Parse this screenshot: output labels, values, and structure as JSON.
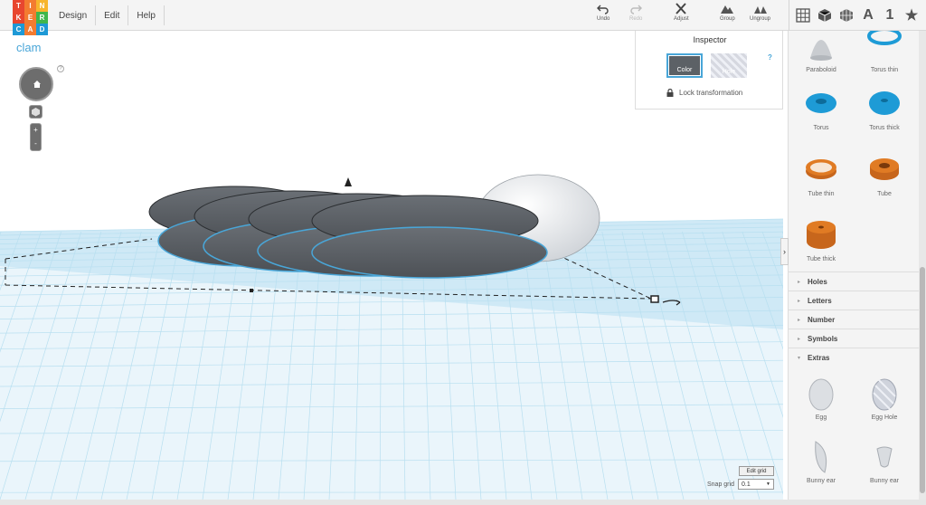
{
  "app": {
    "logo_letters": [
      "T",
      "I",
      "N",
      "K",
      "E",
      "R",
      "C",
      "A",
      "D"
    ],
    "logo_colors": [
      "#e8462f",
      "#f37b30",
      "#f7b52d",
      "#e8462f",
      "#f37b30",
      "#3fb64c",
      "#1e99d6",
      "#f37b30",
      "#1e99d6"
    ]
  },
  "menu": [
    "Design",
    "Edit",
    "Help"
  ],
  "toolbar": {
    "undo": "Undo",
    "redo": "Redo",
    "adjust": "Adjust",
    "group": "Group",
    "ungroup": "Ungroup"
  },
  "view_icons": [
    "grid-view-icon",
    "cube-icon",
    "wireframe-cube-icon",
    "text-A-icon",
    "number-1-icon",
    "star-icon"
  ],
  "view_text": {
    "letter": "A",
    "number": "1",
    "star": "★"
  },
  "project": {
    "name": "clam"
  },
  "nav": {
    "help": "?",
    "zoom_in": "+",
    "zoom_out": "-"
  },
  "inspector": {
    "title": "Inspector",
    "help": "?",
    "color_label": "Color",
    "hole_label": "Hole",
    "lock_label": "Lock transformation",
    "color_value": "#5c6166"
  },
  "grid": {
    "edit_label": "Edit grid",
    "snap_label": "Snap grid",
    "snap_value": "0.1"
  },
  "sidebar": {
    "shapes_top": [
      {
        "label": "Paraboloid",
        "icon": "paraboloid-icon"
      },
      {
        "label": "Torus thin",
        "icon": "torus-thin-icon"
      },
      {
        "label": "Torus",
        "icon": "torus-icon"
      },
      {
        "label": "Torus thick",
        "icon": "torus-thick-icon"
      },
      {
        "label": "Tube thin",
        "icon": "tube-thin-icon"
      },
      {
        "label": "Tube",
        "icon": "tube-icon"
      },
      {
        "label": "Tube thick",
        "icon": "tube-thick-icon"
      }
    ],
    "sections": [
      "Holes",
      "Letters",
      "Number",
      "Symbols",
      "Extras"
    ],
    "extras": [
      {
        "label": "Egg",
        "icon": "egg-icon"
      },
      {
        "label": "Egg Hole",
        "icon": "egg-hole-icon"
      },
      {
        "label": "Bunny ear",
        "icon": "bunny-ear-icon"
      },
      {
        "label": "Bunny ear",
        "icon": "bunny-ear-2-icon"
      }
    ]
  },
  "colors": {
    "accent": "#49a6d8",
    "torus": "#1e9bd6",
    "tube": "#e07b24",
    "shell": "#5c6166"
  }
}
